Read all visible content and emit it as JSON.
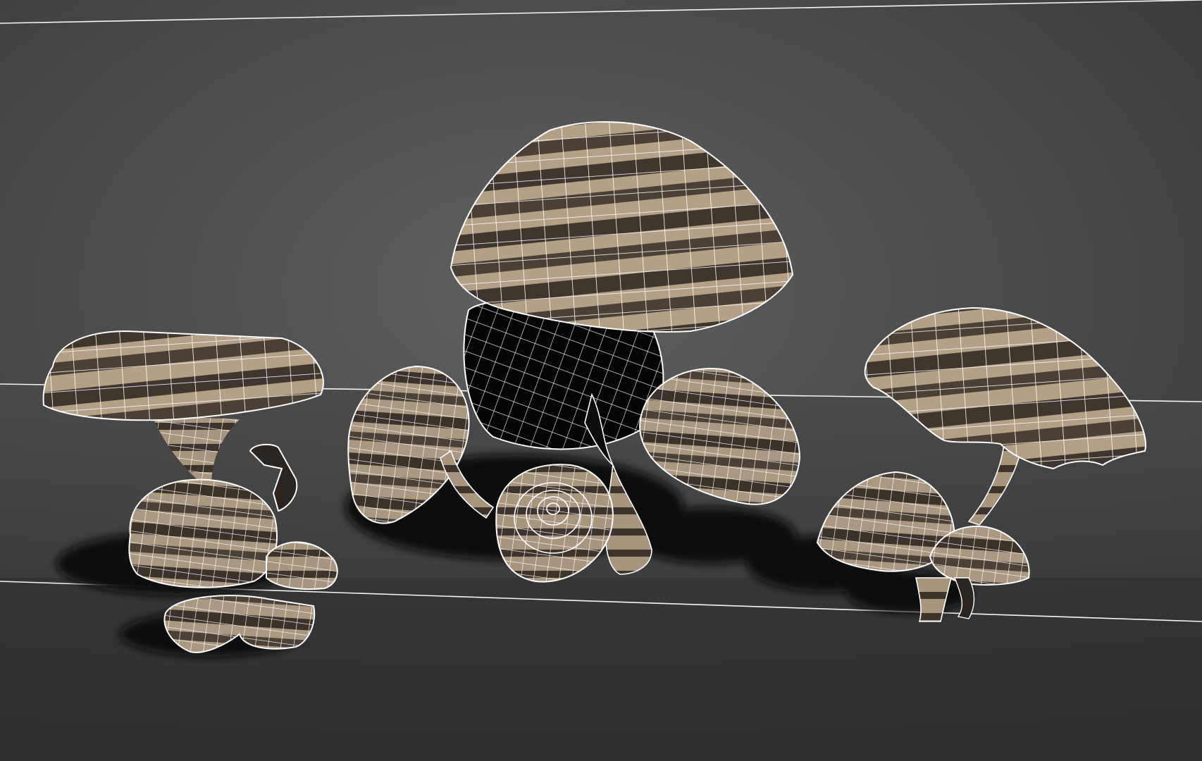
{
  "viewport": {
    "background_top": "#3c3c3c",
    "background_mid": "#5a5a5a",
    "background_floor": "#333333",
    "grid_line_color": "#f4f4f4"
  },
  "scene": {
    "objects": [
      "mushroom-cluster-left",
      "mushroom-cluster-center",
      "mushroom-cluster-right"
    ],
    "material": {
      "stripe_light": "#b8a58a",
      "stripe_dark": "#3d342b",
      "wireframe": "#ffffff",
      "shadow": "#0a0a0a"
    }
  }
}
